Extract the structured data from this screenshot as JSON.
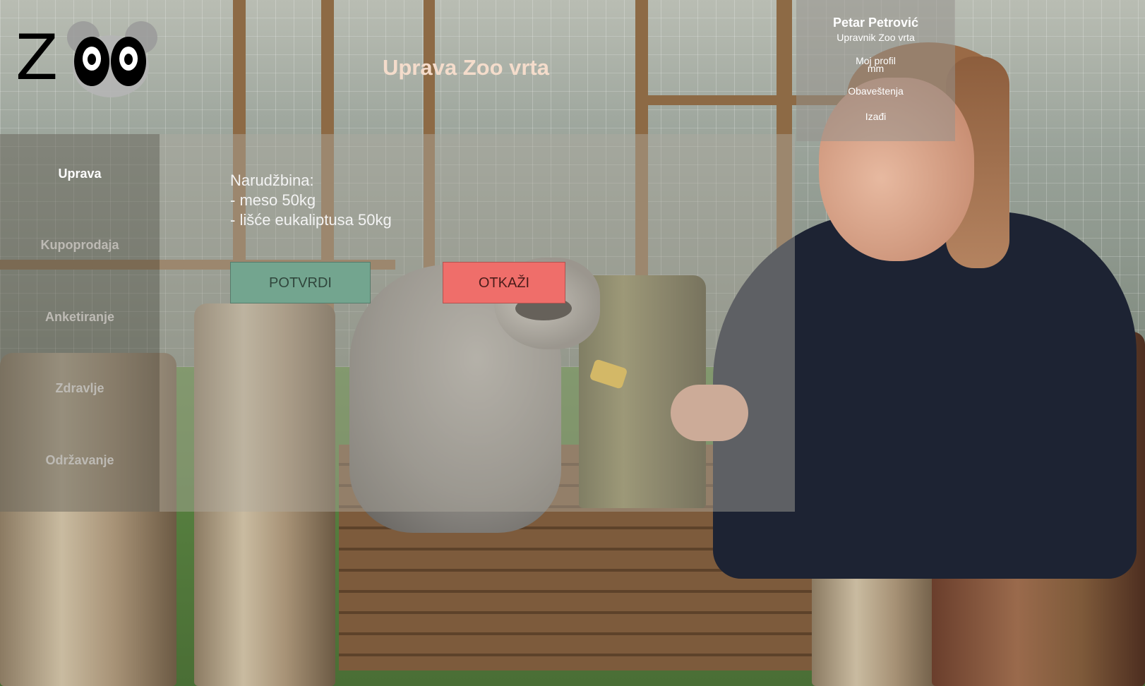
{
  "app": {
    "logo_text": "Z",
    "page_title": "Uprava Zoo vrta"
  },
  "user": {
    "name": "Petar Petrović",
    "role": "Upravnik Zoo vrta",
    "profile_link": "Moj profil\nmm",
    "notifications_link": "Obaveštenja",
    "logout_link": "Izađi"
  },
  "sidebar": {
    "items": [
      {
        "label": "Uprava",
        "active": true
      },
      {
        "label": "Kupoprodaja",
        "active": false
      },
      {
        "label": "Anketiranje",
        "active": false
      },
      {
        "label": "Zdravlje",
        "active": false
      },
      {
        "label": "Održavanje",
        "active": false
      }
    ]
  },
  "order": {
    "title": "Narudžbina:",
    "lines": [
      "- meso 50kg",
      "- lišće eukaliptusa 50kg"
    ],
    "confirm_label": "POTVRDI",
    "cancel_label": "OTKAŽI"
  },
  "colors": {
    "confirm": "#73a58f",
    "cancel": "#ef6e6a",
    "title": "#f4dccb"
  }
}
